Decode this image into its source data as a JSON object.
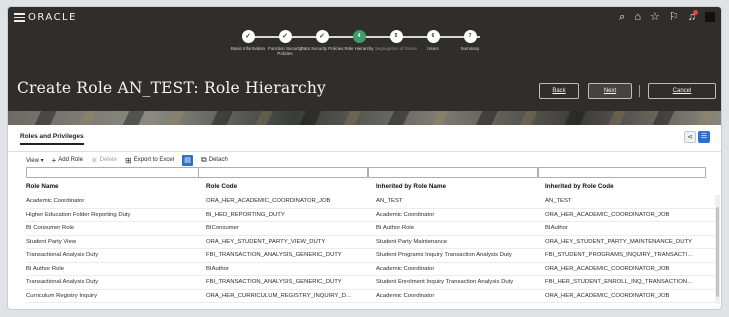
{
  "header": {
    "logo": "ORACLE",
    "title": "Create Role AN_TEST: Role Hierarchy",
    "buttons": {
      "back": "Back",
      "next": "Next",
      "cancel": "Cancel"
    },
    "icons": [
      "search-icon",
      "home-icon",
      "star-icon",
      "flag-icon",
      "bell-icon"
    ]
  },
  "train": [
    {
      "label": "Basic Information",
      "marker": "✓"
    },
    {
      "label": "Function Security Policies",
      "marker": "✓"
    },
    {
      "label": "Data Security Policies",
      "marker": "✓"
    },
    {
      "label": "Role Hierarchy",
      "marker": "4"
    },
    {
      "label": "Segregation of Duties",
      "marker": "5"
    },
    {
      "label": "Users",
      "marker": "6"
    },
    {
      "label": "Summary",
      "marker": "7"
    }
  ],
  "tabs": {
    "active": "Roles and Privileges"
  },
  "toolbar": {
    "view": "View ▾",
    "add_role": "Add Role",
    "delete": "Delete",
    "export": "Export to Excel",
    "detach": "Detach"
  },
  "table": {
    "columns": [
      "Role Name",
      "Role Code",
      "Inherited by Role Name",
      "Inherited by Role Code"
    ],
    "rows": [
      [
        "Academic Coordinator",
        "ORA_HER_ACADEMIC_COORDINATOR_JOB",
        "AN_TEST",
        "AN_TEST"
      ],
      [
        "Higher Education Folder Reporting Duty",
        "BI_HED_REPORTING_DUTY",
        "Academic Coordinator",
        "ORA_HER_ACADEMIC_COORDINATOR_JOB"
      ],
      [
        "BI Consumer Role",
        "BIConsumer",
        "BI Author Role",
        "BIAuthor"
      ],
      [
        "Student Party View",
        "ORA_HEY_STUDENT_PARTY_VIEW_DUTY",
        "Student Party Maintenance",
        "ORA_HEY_STUDENT_PARTY_MAINTENANCE_DUTY"
      ],
      [
        "Transactional Analysis Duty",
        "FBI_TRANSACTION_ANALYSIS_GENERIC_DUTY",
        "Student Programs Inquiry Transaction Analysis Duty",
        "FBI_STUDENT_PROGRAMS_INQUIRY_TRANSACTI…"
      ],
      [
        "BI Author Role",
        "BIAuthor",
        "Academic Coordinator",
        "ORA_HER_ACADEMIC_COORDINATOR_JOB"
      ],
      [
        "Transactional Analysis Duty",
        "FBI_TRANSACTION_ANALYSIS_GENERIC_DUTY",
        "Student Enrolment Inquiry Transaction Analysis Duty",
        "FBI_HER_STUDENT_ENROLL_INQ_TRANSACTION…"
      ],
      [
        "Curriculum Registry Inquiry",
        "ORA_HER_CURRICULUM_REGISTRY_INQUIRY_D…",
        "Academic Coordinator",
        "ORA_HER_ACADEMIC_COORDINATOR_JOB"
      ]
    ]
  }
}
